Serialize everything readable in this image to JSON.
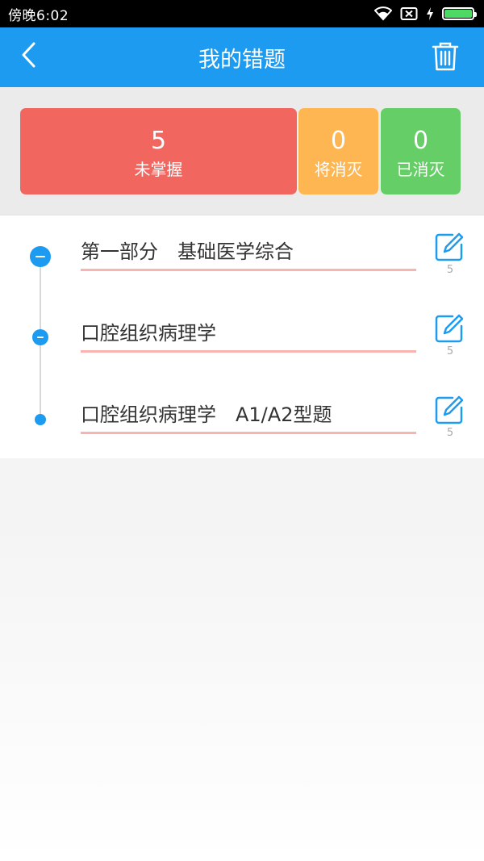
{
  "status_bar": {
    "time": "傍晚6:02",
    "icons": [
      "wifi-icon",
      "sim-icon",
      "charging-icon",
      "battery-icon"
    ]
  },
  "header": {
    "title": "我的错题",
    "back_icon": "chevron-left-icon",
    "delete_icon": "trash-icon",
    "background": "#1d9bf0"
  },
  "summary": {
    "unmastered": {
      "count": "5",
      "label": "未掌握",
      "color": "#f26660"
    },
    "eliminating": {
      "count": "0",
      "label": "将消灭",
      "color": "#feb652"
    },
    "eliminated": {
      "count": "0",
      "label": "已消灭",
      "color": "#66ce66"
    }
  },
  "items": [
    {
      "label": "第一部分　基础医学综合",
      "count": "5",
      "node": "collapse-icon"
    },
    {
      "label": "口腔组织病理学",
      "count": "5",
      "node": "collapse-icon"
    },
    {
      "label": "口腔组织病理学　A1/A2型题",
      "count": "5",
      "node": "leaf-dot-icon"
    }
  ],
  "colors": {
    "accent": "#1d9bf0",
    "underline": "#f7b4b1"
  }
}
